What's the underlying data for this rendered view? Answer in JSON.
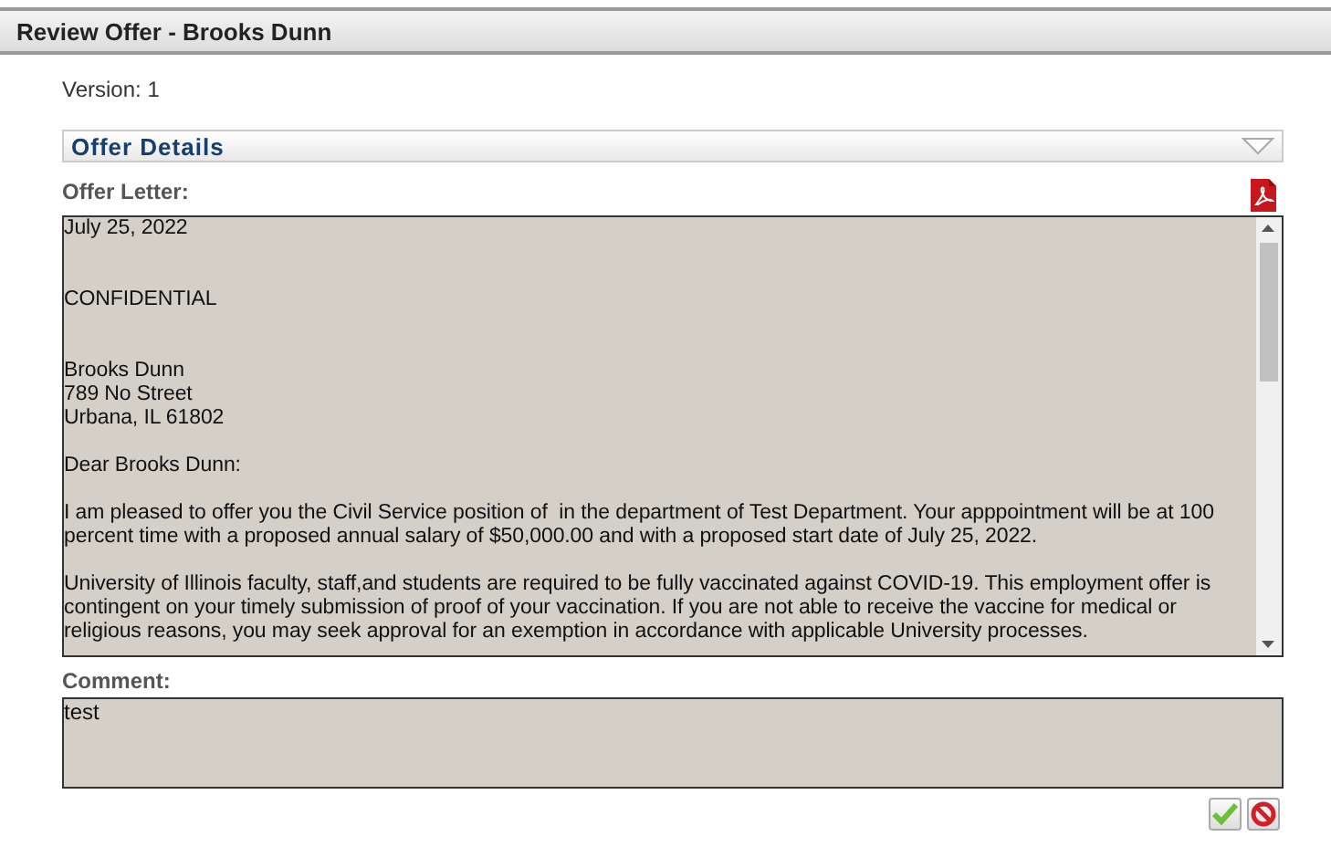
{
  "window": {
    "title": "Review Offer - Brooks Dunn"
  },
  "version": {
    "label": "Version:",
    "value": "1"
  },
  "section": {
    "title": "Offer Details",
    "expanded": true
  },
  "offer_letter": {
    "label": "Offer Letter:",
    "text": "July 25, 2022\n\n\nCONFIDENTIAL\n\n\nBrooks Dunn\n789 No Street\nUrbana, IL 61802\n\nDear Brooks Dunn:\n\nI am pleased to offer you the Civil Service position of  in the department of Test Department. Your apppointment will be at 100 percent time with a proposed annual salary of $50,000.00 and with a proposed start date of July 25, 2022.\n\nUniversity of Illinois faculty, staff,and students are required to be fully vaccinated against COVID-19. This employment offer is contingent on your timely submission of proof of your vaccination. If you are not able to receive the vaccine for medical or religious reasons, you may seek approval for an exemption in accordance with applicable University processes."
  },
  "comment": {
    "label": "Comment:",
    "value": "test"
  },
  "buttons": [
    {
      "kind": "approve"
    },
    {
      "kind": "reject"
    }
  ]
}
